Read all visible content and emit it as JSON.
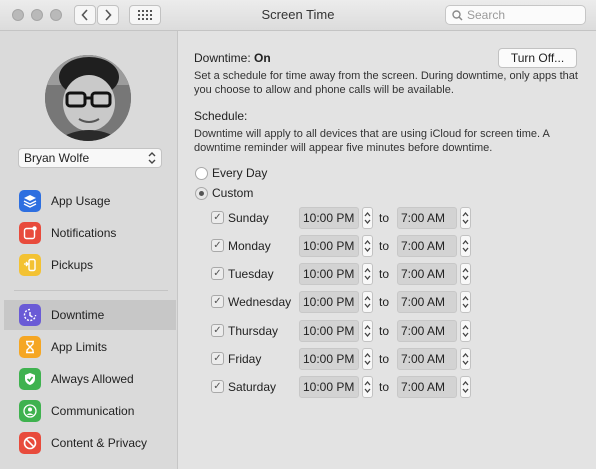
{
  "window": {
    "title": "Screen Time"
  },
  "toolbar": {
    "search_placeholder": "Search"
  },
  "sidebar": {
    "user": "Bryan Wolfe",
    "items": [
      {
        "label": "App Usage",
        "icon": "layers-icon",
        "color": "#2d6fe0"
      },
      {
        "label": "Notifications",
        "icon": "notification-icon",
        "color": "#e84b3c"
      },
      {
        "label": "Pickups",
        "icon": "pickup-icon",
        "color": "#f3c233"
      },
      {
        "label": "Downtime",
        "icon": "downtime-icon",
        "color": "#6a5bd6",
        "selected": true
      },
      {
        "label": "App Limits",
        "icon": "hourglass-icon",
        "color": "#f5a623"
      },
      {
        "label": "Always Allowed",
        "icon": "checkmark-shield-icon",
        "color": "#3fb24f"
      },
      {
        "label": "Communication",
        "icon": "person-icon",
        "color": "#3fb24f"
      },
      {
        "label": "Content & Privacy",
        "icon": "no-entry-icon",
        "color": "#e84b3c"
      }
    ]
  },
  "downtime": {
    "label": "Downtime:",
    "status": "On",
    "button": "Turn Off...",
    "description": "Set a schedule for time away from the screen. During downtime, only apps that you choose to allow and phone calls will be available.",
    "schedule_label": "Schedule:",
    "schedule_description": "Downtime will apply to all devices that are using iCloud for screen time. A downtime reminder will appear five minutes before downtime.",
    "options": [
      {
        "label": "Every Day",
        "selected": false
      },
      {
        "label": "Custom",
        "selected": true
      }
    ],
    "to_label": "to",
    "days": [
      {
        "name": "Sunday",
        "checked": true,
        "start": "10:00 PM",
        "end": "7:00 AM"
      },
      {
        "name": "Monday",
        "checked": true,
        "start": "10:00 PM",
        "end": "7:00 AM"
      },
      {
        "name": "Tuesday",
        "checked": true,
        "start": "10:00 PM",
        "end": "7:00 AM"
      },
      {
        "name": "Wednesday",
        "checked": true,
        "start": "10:00 PM",
        "end": "7:00 AM"
      },
      {
        "name": "Thursday",
        "checked": true,
        "start": "10:00 PM",
        "end": "7:00 AM"
      },
      {
        "name": "Friday",
        "checked": true,
        "start": "10:00 PM",
        "end": "7:00 AM"
      },
      {
        "name": "Saturday",
        "checked": true,
        "start": "10:00 PM",
        "end": "7:00 AM"
      }
    ]
  }
}
